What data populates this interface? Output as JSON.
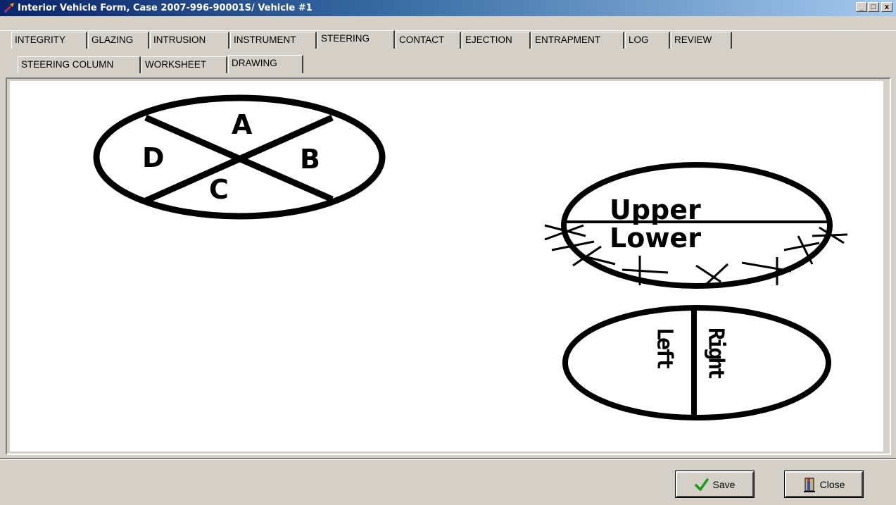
{
  "window": {
    "title": "Interior Vehicle Form, Case 2007-996-90001S/ Vehicle #1",
    "minimize": "_",
    "maximize": "□",
    "close": "x"
  },
  "main_tabs": [
    {
      "label": "INTEGRITY"
    },
    {
      "label": "GLAZING"
    },
    {
      "label": "INTRUSION"
    },
    {
      "label": "INSTRUMENT"
    },
    {
      "label": "STEERING",
      "active": true
    },
    {
      "label": "CONTACT"
    },
    {
      "label": "EJECTION"
    },
    {
      "label": "ENTRAPMENT"
    },
    {
      "label": "LOG"
    },
    {
      "label": "REVIEW"
    }
  ],
  "sub_tabs": [
    {
      "label": "STEERING COLUMN"
    },
    {
      "label": "WORKSHEET"
    },
    {
      "label": "DRAWING",
      "active": true
    }
  ],
  "drawing": {
    "quadrant_labels": {
      "a": "A",
      "b": "B",
      "c": "C",
      "d": "D"
    },
    "hub": {
      "upper": "Upper",
      "lower": "Lower"
    },
    "side": {
      "left": "Left",
      "right": "Right"
    }
  },
  "buttons": {
    "save": "Save",
    "close": "Close"
  },
  "colors": {
    "titlebar_start": "#0a246a",
    "titlebar_end": "#a6caf0",
    "face": "#d4d0c8",
    "save_check": "#1a9a1a"
  }
}
